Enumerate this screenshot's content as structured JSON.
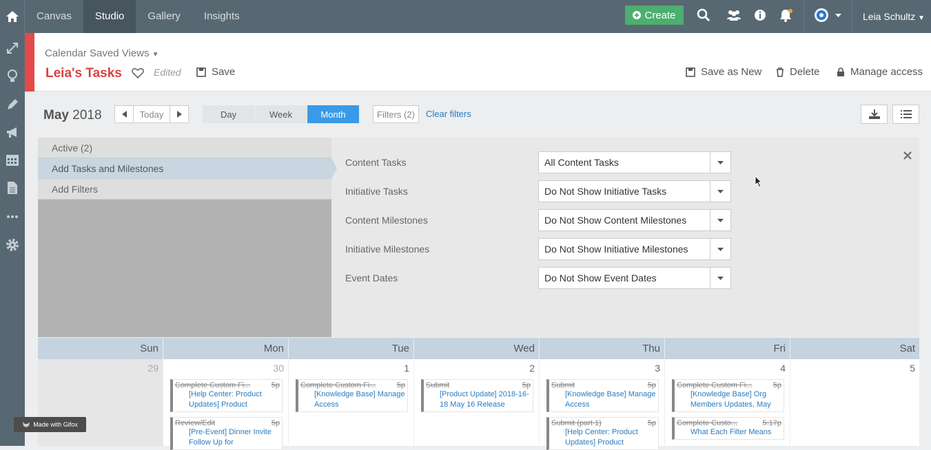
{
  "topnav": {
    "tabs": [
      "Canvas",
      "Studio",
      "Gallery",
      "Insights"
    ],
    "active": "Studio",
    "create_label": "Create",
    "user": "Leia Schultz"
  },
  "header": {
    "saved_views": "Calendar Saved Views",
    "title": "Leia's Tasks",
    "edited": "Edited",
    "save": "Save",
    "save_as_new": "Save as New",
    "delete": "Delete",
    "manage_access": "Manage access"
  },
  "toolbar": {
    "month": "May",
    "year": "2018",
    "today": "Today",
    "views": [
      "Day",
      "Week",
      "Month"
    ],
    "active_view": "Month",
    "filters": "Filters (2)",
    "clear_filters": "Clear filters"
  },
  "panel": {
    "left_items": [
      "Active (2)",
      "Add Tasks and Milestones",
      "Add Filters"
    ],
    "selected": "Add Tasks and Milestones",
    "filters": [
      {
        "label": "Content Tasks",
        "value": "All Content Tasks"
      },
      {
        "label": "Initiative Tasks",
        "value": "Do Not Show Initiative Tasks"
      },
      {
        "label": "Content Milestones",
        "value": "Do Not Show Content Milestones"
      },
      {
        "label": "Initiative Milestones",
        "value": "Do Not Show Initiative Milestones"
      },
      {
        "label": "Event Dates",
        "value": "Do Not Show Event Dates"
      }
    ]
  },
  "calendar": {
    "days": [
      "Sun",
      "Mon",
      "Tue",
      "Wed",
      "Thu",
      "Fri",
      "Sat"
    ],
    "dates": [
      "29",
      "30",
      "1",
      "2",
      "3",
      "4",
      "5"
    ],
    "events": {
      "mon": [
        {
          "task": "Complete Custom Fi...",
          "time": "5p",
          "title": "[Help Center: Product Updates] Product"
        },
        {
          "task": "Review/Edit",
          "time": "5p",
          "title": "[Pre-Event] Dinner Invite Follow Up for"
        }
      ],
      "tue": [
        {
          "task": "Complete Custom Fi...",
          "time": "5p",
          "title": "[Knowledge Base] Manage Access"
        }
      ],
      "wed": [
        {
          "task": "Submit",
          "time": "5p",
          "title": "[Product Update] 2018-16-18 May 16 Release"
        }
      ],
      "thu": [
        {
          "task": "Submit",
          "time": "5p",
          "title": "[Knowledge Base] Manage Access"
        },
        {
          "task": "Submit (part 1)",
          "time": "5p",
          "title": "[Help Center: Product Updates] Product"
        }
      ],
      "fri": [
        {
          "task": "Complete Custom Fi...",
          "time": "5p",
          "title": "[Knowledge Base] Org Members Updates, May"
        },
        {
          "task": "Complete Custo...",
          "time": "5:17p",
          "title": "What Each Filter Means"
        }
      ]
    }
  },
  "watermark": "Made with Gifox",
  "colors": {
    "topbar": "#586872",
    "accent_red": "#d9413e",
    "create_green": "#4cae6f",
    "month_blue": "#3a9ae8"
  }
}
